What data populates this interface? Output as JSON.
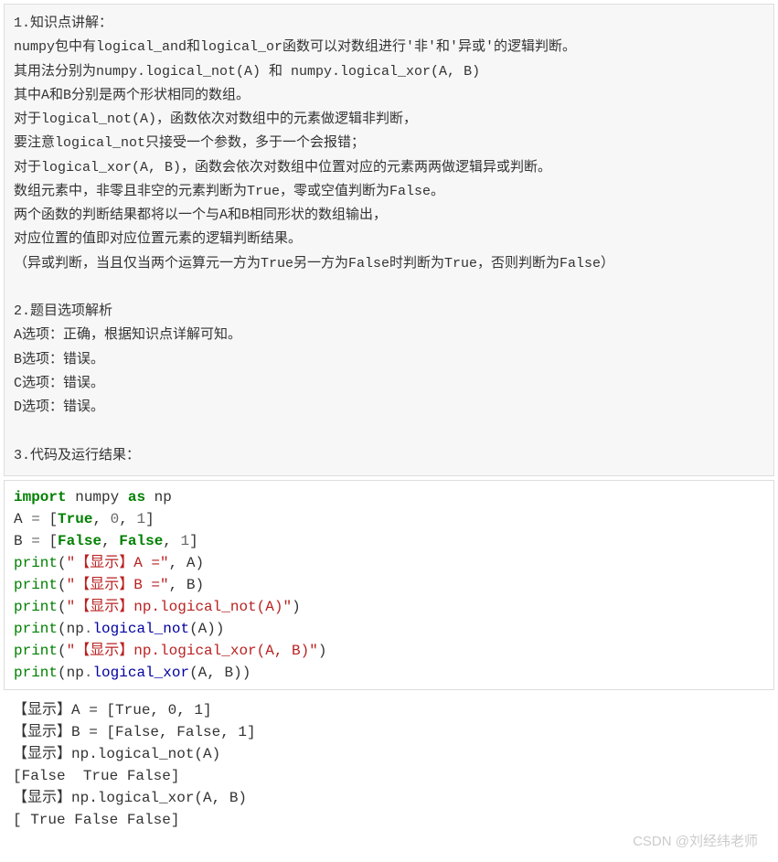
{
  "explanation": {
    "h1": "1.知识点讲解：",
    "p1": "numpy包中有logical_and和logical_or函数可以对数组进行'非'和'异或'的逻辑判断。",
    "p2": "其用法分别为numpy.logical_not(A) 和 numpy.logical_xor(A, B)",
    "p3": "其中A和B分别是两个形状相同的数组。",
    "p4": "对于logical_not(A)，函数依次对数组中的元素做逻辑非判断，",
    "p5": "要注意logical_not只接受一个参数，多于一个会报错；",
    "p6": "对于logical_xor(A, B)，函数会依次对数组中位置对应的元素两两做逻辑异或判断。",
    "p7": "数组元素中，非零且非空的元素判断为True，零或空值判断为False。",
    "p8": "两个函数的判断结果都将以一个与A和B相同形状的数组输出，",
    "p9": "对应位置的值即对应位置元素的逻辑判断结果。",
    "p10": "（异或判断，当且仅当两个运算元一方为True另一方为False时判断为True，否则判断为False）",
    "h2": "2.题目选项解析",
    "oa": "A选项：正确，根据知识点详解可知。",
    "ob": "B选项：错误。",
    "oc": "C选项：错误。",
    "od": "D选项：错误。",
    "h3": "3.代码及运行结果："
  },
  "code": {
    "kw_import": "import",
    "mod": "numpy",
    "kw_as": "as",
    "alias": "np",
    "varA": "A",
    "varB": "B",
    "eq": "=",
    "lb": "[",
    "rb": "]",
    "comma": ",",
    "true": "True",
    "false": "False",
    "zero": "0",
    "one": "1",
    "print": "print",
    "lp": "(",
    "rp": ")",
    "s_show_a": "\"【显示】A =\"",
    "s_show_b": "\"【显示】B =\"",
    "s_show_not": "\"【显示】np.logical_not(A)\"",
    "s_show_xor": "\"【显示】np.logical_xor(A, B)\"",
    "np": "np",
    "dot": ".",
    "fn_not": "logical_not",
    "fn_xor": "logical_xor"
  },
  "output": {
    "l1": "【显示】A = [True, 0, 1]",
    "l2": "【显示】B = [False, False, 1]",
    "l3": "【显示】np.logical_not(A)",
    "l4": "[False  True False]",
    "l5": "【显示】np.logical_xor(A, B)",
    "l6": "[ True False False]"
  },
  "watermark": "CSDN @刘经纬老师"
}
